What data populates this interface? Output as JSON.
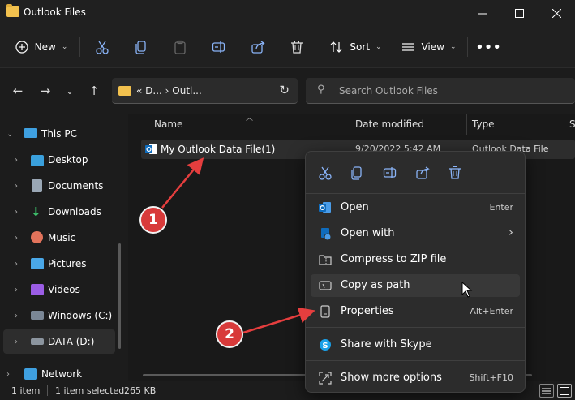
{
  "window": {
    "title": "Outlook Files"
  },
  "commandbar": {
    "new_label": "New",
    "sort_label": "Sort",
    "view_label": "View"
  },
  "address": {
    "crumbs": "«  D...  ›  Outl..."
  },
  "search": {
    "placeholder": "Search Outlook Files"
  },
  "sidebar": {
    "items": [
      {
        "label": "This PC"
      },
      {
        "label": "Desktop"
      },
      {
        "label": "Documents"
      },
      {
        "label": "Downloads"
      },
      {
        "label": "Music"
      },
      {
        "label": "Pictures"
      },
      {
        "label": "Videos"
      },
      {
        "label": "Windows (C:)"
      },
      {
        "label": "DATA (D:)"
      },
      {
        "label": "Network"
      }
    ]
  },
  "columns": {
    "name": "Name",
    "date": "Date modified",
    "type": "Type",
    "size": "S"
  },
  "file": {
    "name": "My Outlook Data File(1)",
    "date": "9/20/2022 5:42 AM",
    "type": "Outlook Data File"
  },
  "context_menu": {
    "items": [
      {
        "label": "Open",
        "shortcut": "Enter"
      },
      {
        "label": "Open with",
        "shortcut": "›"
      },
      {
        "label": "Compress to ZIP file",
        "shortcut": ""
      },
      {
        "label": "Copy as path",
        "shortcut": ""
      },
      {
        "label": "Properties",
        "shortcut": "Alt+Enter"
      },
      {
        "label": "Share with Skype",
        "shortcut": ""
      },
      {
        "label": "Show more options",
        "shortcut": "Shift+F10"
      }
    ]
  },
  "annotations": {
    "step1": "1",
    "step2": "2",
    "color": "#d83a3a"
  },
  "status": {
    "count": "1 item",
    "selected": "1 item selected",
    "size": "265 KB"
  }
}
